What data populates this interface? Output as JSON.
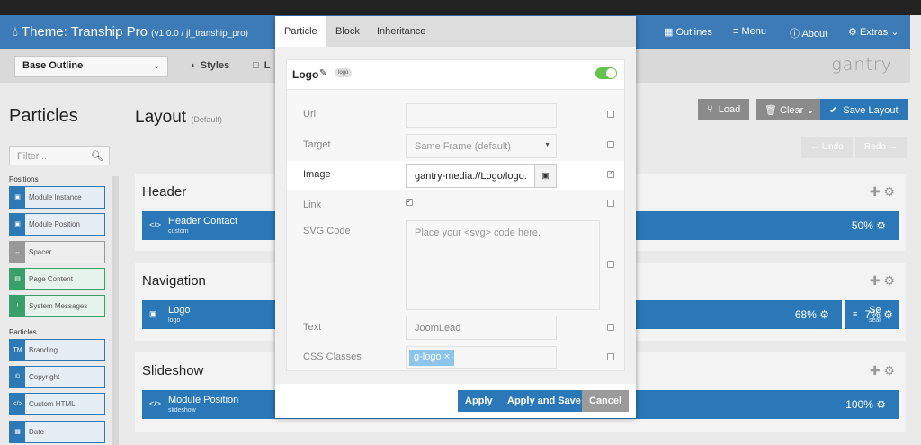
{
  "header": {
    "title": "Theme: Tranship Pro",
    "version": "(v1.0.0 / jl_tranship_pro)",
    "nav": [
      "Outlines",
      "Menu",
      "About",
      "Extras"
    ]
  },
  "subbar": {
    "outline": "Base Outline",
    "tab_styles": "Styles",
    "tab_layout_partial": "L",
    "brand": "gantry"
  },
  "sidebar": {
    "title": "Particles",
    "filter_placeholder": "Filter...",
    "positions_heading": "Positions",
    "positions": [
      "Module Instance",
      "Module Position",
      "Spacer",
      "Page Content",
      "System Messages"
    ],
    "particles_heading": "Particles",
    "particles": [
      "Branding",
      "Copyright",
      "Custom HTML",
      "Date"
    ]
  },
  "layout": {
    "title": "Layout",
    "subtitle": "(Default)",
    "load": "Load",
    "clear": "Clear",
    "save": "Save Layout",
    "undo": "Undo",
    "redo": "Redo",
    "sections": [
      {
        "name": "Header",
        "row": {
          "name": "Header Contact",
          "sub": "custom",
          "pct": "50%"
        }
      },
      {
        "name": "Navigation",
        "row": {
          "name": "Logo",
          "sub": "logo",
          "pct": "68%"
        },
        "extra": {
          "name": "Se",
          "sub": "sear",
          "pct": "7%"
        }
      },
      {
        "name": "Slideshow",
        "row": {
          "name": "Module Position",
          "sub": "slideshow",
          "pct": "100%"
        }
      }
    ]
  },
  "modal": {
    "tabs": [
      "Particle",
      "Block",
      "Inheritance"
    ],
    "particle_title": "Logo",
    "particle_tag": "logo",
    "fields": {
      "url_label": "Url",
      "target_label": "Target",
      "target_value": "Same Frame (default)",
      "image_label": "Image",
      "image_value": "gantry-media://Logo/logo.",
      "link_label": "Link",
      "svg_label": "SVG Code",
      "svg_placeholder": "Place your <svg> code here.",
      "text_label": "Text",
      "text_value": "JoomLead",
      "css_label": "CSS Classes",
      "css_chip": "g-logo"
    },
    "buttons": {
      "apply": "Apply",
      "apply_save": "Apply and Save",
      "cancel": "Cancel"
    }
  },
  "colors": {
    "primary": "#2a78b8",
    "topbar": "#3d7bb6",
    "toggle": "#65c24a",
    "cancel": "#9b9b9b"
  }
}
